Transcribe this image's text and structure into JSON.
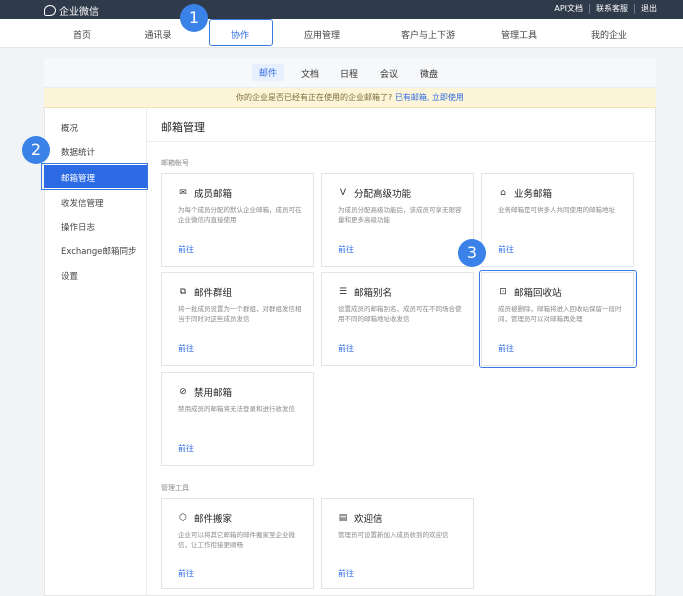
{
  "topbar": {
    "logo_text": "企业微信",
    "links": [
      "API文档",
      "联系客服",
      "退出"
    ]
  },
  "main_nav": {
    "items": [
      "首页",
      "通讯录",
      "协作",
      "应用管理",
      "客户与上下游",
      "管理工具",
      "我的企业"
    ],
    "active_index": 2
  },
  "sub_nav": {
    "items": [
      "邮件",
      "文档",
      "日程",
      "会议",
      "微盘"
    ],
    "active_index": 0
  },
  "notice": {
    "text": "你的企业是否已经有正在使用的企业邮箱了?",
    "link_text": "已有邮箱, 立即使用"
  },
  "sidebar": {
    "items": [
      "概况",
      "数据统计",
      "邮箱管理",
      "收发信管理",
      "操作日志",
      "Exchange邮箱同步",
      "设置"
    ],
    "active_index": 2
  },
  "page": {
    "title": "邮箱管理",
    "sections": [
      "邮箱帐号",
      "管理工具"
    ]
  },
  "cards": [
    {
      "title": "成员邮箱",
      "icon": "envelope-icon",
      "desc": "为每个成员分配的默认企业邮箱，成员可在企业微信内直接使用",
      "link": "前往"
    },
    {
      "title": "分配高级功能",
      "icon": "vip-icon",
      "desc": "为成员分配高级功能后，该成员可享无限容量和更多高级功能",
      "link": "前往"
    },
    {
      "title": "业务邮箱",
      "icon": "business-icon",
      "desc": "业务邮箱是可供多人共同使用的邮箱地址",
      "link": "前往"
    },
    {
      "title": "邮件群组",
      "icon": "group-icon",
      "desc": "将一批成员设置为一个群组，对群组发信相当于同时对这些成员发信",
      "link": "前往"
    },
    {
      "title": "邮箱别名",
      "icon": "alias-icon",
      "desc": "设置成员的邮箱别名，成员可在不同场合使用不同的邮箱地址收发信",
      "link": "前往"
    },
    {
      "title": "邮箱回收站",
      "icon": "recycle-icon",
      "desc": "成员被删除，邮箱将进入回收站保留一段时间，管理员可以对邮箱再处理",
      "link": "前往"
    },
    {
      "title": "禁用邮箱",
      "icon": "ban-icon",
      "desc": "禁用成员的邮箱将无法登录和进行收发信",
      "link": "前往"
    },
    {
      "title": "邮件搬家",
      "icon": "move-icon",
      "desc": "企业可以将其它邮箱的邮件搬家至企业微信，让工作衔接更顺畅",
      "link": "前往"
    },
    {
      "title": "欢迎信",
      "icon": "welcome-icon",
      "desc": "管理员可设置新加入成员收到的欢迎信",
      "link": "前往"
    }
  ],
  "annotations": [
    "1",
    "2",
    "3"
  ]
}
